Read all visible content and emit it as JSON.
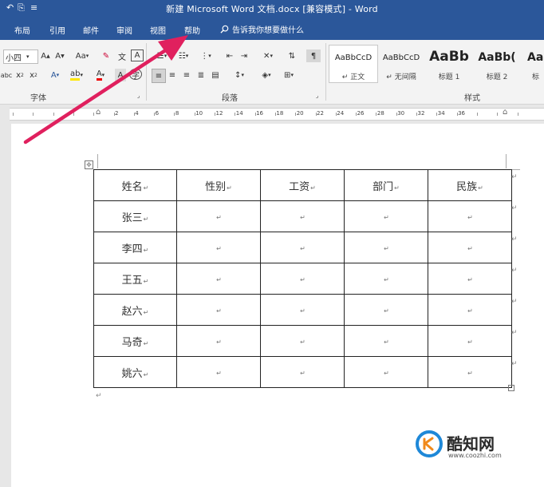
{
  "titlebar": {
    "title": "新建 Microsoft Word 文档.docx [兼容模式]  -  Word"
  },
  "tabs": [
    "布局",
    "引用",
    "邮件",
    "审阅",
    "视图",
    "帮助"
  ],
  "tellme": {
    "text": "告诉我你想要做什么"
  },
  "ribbon": {
    "font_size": "小四",
    "aa_label": "Aa",
    "font_group_label": "字体",
    "paragraph_group_label": "段落",
    "styles_group_label": "样式",
    "styles": [
      {
        "preview": "AaBbCcD",
        "name": "↵ 正文"
      },
      {
        "preview": "AaBbCcD",
        "name": "↵ 无间隔"
      },
      {
        "preview": "AaBb",
        "name": "标题 1"
      },
      {
        "preview": "AaBb(",
        "name": "标题 2"
      },
      {
        "preview": "Aa",
        "name": "标"
      }
    ]
  },
  "ruler": {
    "ticks": [
      "2",
      "4",
      "6",
      "8",
      "10",
      "12",
      "14",
      "16",
      "18",
      "20",
      "22",
      "24",
      "26",
      "28",
      "30",
      "32",
      "34",
      "36"
    ]
  },
  "table": {
    "headers": [
      "姓名",
      "性别",
      "工资",
      "部门",
      "民族"
    ],
    "rows": [
      [
        "张三",
        "",
        "",
        "",
        ""
      ],
      [
        "李四",
        "",
        "",
        "",
        ""
      ],
      [
        "王五",
        "",
        "",
        "",
        ""
      ],
      [
        "赵六",
        "",
        "",
        "",
        ""
      ],
      [
        "马奇",
        "",
        "",
        "",
        ""
      ],
      [
        "姚六",
        "",
        "",
        "",
        ""
      ]
    ],
    "mark": "↵"
  },
  "watermark": {
    "name": "酷知网",
    "url": "www.coozhi.com"
  },
  "colors": {
    "ribbon_blue": "#2b579a",
    "arrow": "#e0205e",
    "watermark_blue": "#1e88d8"
  },
  "icons": [
    "save-icon",
    "search-icon",
    "arrow-annotation"
  ]
}
